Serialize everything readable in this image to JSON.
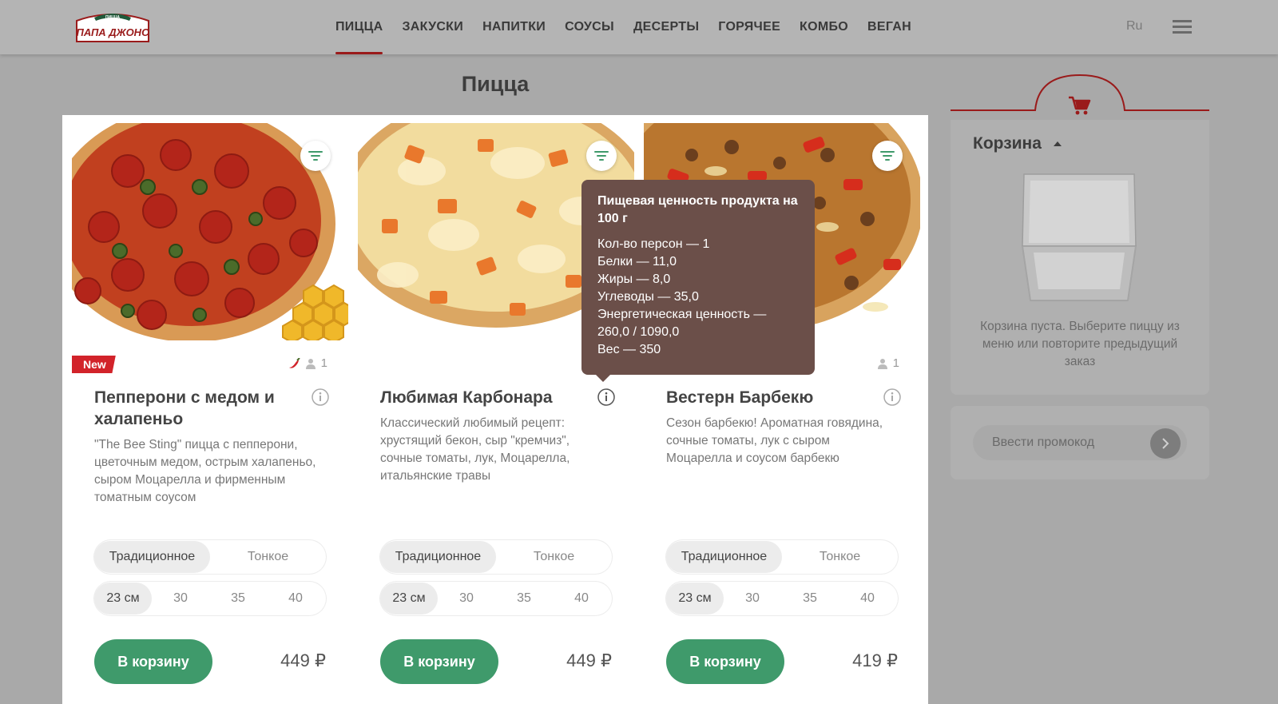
{
  "header": {
    "logo_text": "ПАПА ДЖОНС",
    "logo_sub": "ПИЦЦА",
    "nav": [
      "ПИЦЦА",
      "ЗАКУСКИ",
      "НАПИТКИ",
      "СОУСЫ",
      "ДЕСЕРТЫ",
      "ГОРЯЧЕЕ",
      "КОМБО",
      "ВЕГАН"
    ],
    "active_nav": "ПИЦЦА",
    "lang": "Ru"
  },
  "page_title": "Пицца",
  "products": [
    {
      "name": "Пепперони с медом и халапеньо",
      "badge": "New",
      "persons": "1",
      "spicy": true,
      "description": "\"The Bee Sting\" пицца с пепперони, цветочным медом, острым халапеньо, сыром Моцарелла и фирменным томатным соусом",
      "dough": [
        "Традиционное",
        "Тонкое"
      ],
      "sizes": [
        "23 см",
        "30",
        "35",
        "40"
      ],
      "cart_label": "В корзину",
      "price": "449 ₽"
    },
    {
      "name": "Любимая Карбонара",
      "description": "Классический любимый рецепт: хрустящий бекон, сыр \"кремчиз\", сочные томаты, лук, Моцарелла, итальянские травы",
      "dough": [
        "Традиционное",
        "Тонкое"
      ],
      "sizes": [
        "23 см",
        "30",
        "35",
        "40"
      ],
      "cart_label": "В корзину",
      "price": "449 ₽"
    },
    {
      "name": "Вестерн Барбекю",
      "persons": "1",
      "description": "Сезон барбекю! Ароматная говядина, сочные томаты, лук с сыром Моцарелла и соусом барбекю",
      "dough": [
        "Традиционное",
        "Тонкое"
      ],
      "sizes": [
        "23 см",
        "30",
        "35",
        "40"
      ],
      "cart_label": "В корзину",
      "price": "419 ₽"
    }
  ],
  "tooltip": {
    "title": "Пищевая ценность продукта на 100 г",
    "lines": [
      "Кол-во персон — 1",
      "Белки — 11,0",
      "Жиры — 8,0",
      "Углеводы — 35,0",
      "Энергетическая ценность — 260,0 / 1090,0",
      "Вес — 350"
    ]
  },
  "cart": {
    "title": "Корзина",
    "empty_text": "Корзина пуста. Выберите пиццу из меню или повторите предыдущий заказ",
    "promo_placeholder": "Ввести промокод"
  },
  "colors": {
    "accent_green": "#3f9a6b",
    "brand_red": "#9a1b1b",
    "new_badge": "#d2232a",
    "tooltip_bg": "#6b4f49"
  },
  "icons": [
    "cart-icon",
    "filter-icon",
    "info-icon",
    "person-icon",
    "chili-icon",
    "menu-icon",
    "chevron-right-icon"
  ]
}
